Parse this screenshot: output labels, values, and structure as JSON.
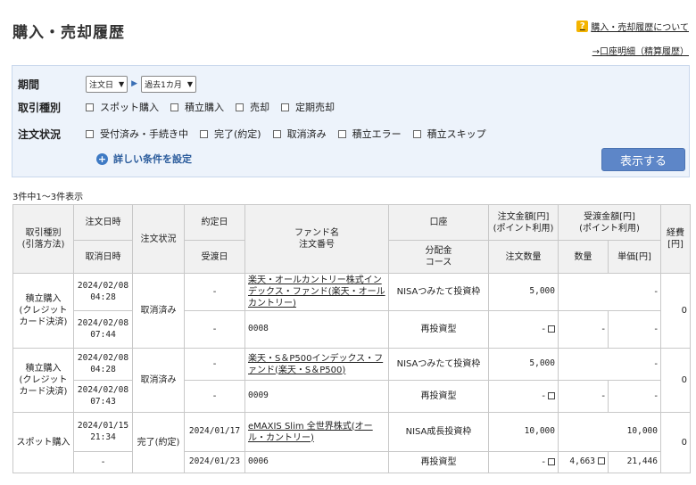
{
  "page": {
    "title": "購入・売却履歴",
    "help_link": "購入・売却履歴について",
    "help_icon": "?",
    "account_link": "→口座明細（精算履歴）"
  },
  "filters": {
    "period_label": "期間",
    "period_type": "注文日",
    "period_range": "過去1カ月",
    "trade_type_label": "取引種別",
    "trade_types": [
      "スポット購入",
      "積立購入",
      "売却",
      "定期売却"
    ],
    "status_label": "注文状況",
    "statuses": [
      "受付済み・手続き中",
      "完了(約定)",
      "取消済み",
      "積立エラー",
      "積立スキップ"
    ],
    "detail_link": "詳しい条件を設定",
    "show_button": "表示する"
  },
  "result_count": "3件中1〜3件表示",
  "table": {
    "headers": {
      "trade_type": "取引種別\n(引落方法)",
      "order_date": "注文日時",
      "cancel_date": "取消日時",
      "status": "注文状況",
      "exec_date": "約定日",
      "delivery_date": "受渡日",
      "fund": "ファンド名\n注文番号",
      "account": "口座",
      "dist": "分配金\nコース",
      "order_amount": "注文金額[円]\n(ポイント利用)",
      "order_qty": "注文数量",
      "delivery_amount": "受渡金額[円]\n(ポイント利用)",
      "qty": "数量",
      "unit_price": "単価[円]",
      "fee": "経費\n[円]"
    },
    "rows": [
      {
        "trade_type": "積立購入\n(クレジットカード決済)",
        "order_date": "2024/02/08\n04:28",
        "cancel_date": "2024/02/08\n07:44",
        "status": "取消済み",
        "exec_date": "-",
        "delivery_date": "-",
        "fund": "楽天・オールカントリー株式インデックス・ファンド(楽天・オールカントリー)",
        "order_no": "0008",
        "account": "NISAつみたて投資枠",
        "dist": "再投資型",
        "order_amount": "5,000",
        "order_qty": "-",
        "delivery_amount": "-",
        "qty": "-",
        "unit_price": "-",
        "fee": "0"
      },
      {
        "trade_type": "積立購入\n(クレジットカード決済)",
        "order_date": "2024/02/08\n04:28",
        "cancel_date": "2024/02/08\n07:43",
        "status": "取消済み",
        "exec_date": "-",
        "delivery_date": "-",
        "fund": "楽天・S＆P500インデックス・ファンド(楽天・S＆P500)",
        "order_no": "0009",
        "account": "NISAつみたて投資枠",
        "dist": "再投資型",
        "order_amount": "5,000",
        "order_qty": "-",
        "delivery_amount": "-",
        "qty": "-",
        "unit_price": "-",
        "fee": "0"
      },
      {
        "trade_type": "スポット購入",
        "order_date": "2024/01/15\n21:34",
        "cancel_date": "-",
        "status": "完了(約定)",
        "exec_date": "2024/01/17",
        "delivery_date": "2024/01/23",
        "fund": "eMAXIS Slim 全世界株式(オール・カントリー)",
        "order_no": "0006",
        "account": "NISA成長投資枠",
        "dist": "再投資型",
        "order_amount": "10,000",
        "order_qty": "-",
        "delivery_amount": "10,000",
        "qty": "4,663",
        "unit_price": "21,446",
        "fee": "0"
      }
    ]
  }
}
